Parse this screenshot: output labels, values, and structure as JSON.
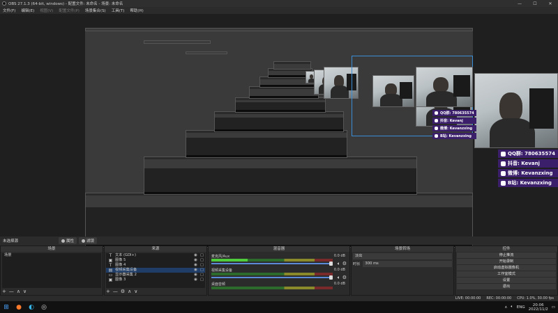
{
  "window": {
    "title": "OBS 27.1.3 (64-bit, windows) - 配置文件: 未命名 - 场景: 未命名",
    "minimize": "—",
    "maximize": "☐",
    "close": "✕"
  },
  "menu": [
    {
      "label": "文件(F)",
      "dim": false
    },
    {
      "label": "编辑(E)",
      "dim": false
    },
    {
      "label": "视图(V)",
      "dim": true
    },
    {
      "label": "配置文件(P)",
      "dim": true
    },
    {
      "label": "场景集合(S)",
      "dim": false
    },
    {
      "label": "工具(T)",
      "dim": false
    },
    {
      "label": "帮助(H)",
      "dim": false
    }
  ],
  "overlay": {
    "rows": [
      {
        "label": "QQ群: 780635574"
      },
      {
        "label": "抖音: Kevanj"
      },
      {
        "label": "微博: Kevanzxing"
      },
      {
        "label": "B站: Kevanzxing"
      }
    ]
  },
  "toolbar": {
    "scene_name": "未选择源",
    "properties": "属性",
    "filters": "滤镜"
  },
  "scenes": {
    "title": "场景",
    "items": [
      "场景"
    ],
    "add": "+",
    "remove": "—",
    "up": "∧",
    "down": "∨"
  },
  "sources": {
    "title": "来源",
    "items": [
      {
        "icon": "T",
        "label": "文本 (GDI+)"
      },
      {
        "icon": "▣",
        "label": "图像 5"
      },
      {
        "icon": "T",
        "label": "图像 4"
      },
      {
        "icon": "▤",
        "label": "视频采集设备"
      },
      {
        "icon": "▭",
        "label": "显示器采集 2"
      },
      {
        "icon": "▣",
        "label": "图像 3"
      }
    ],
    "add": "+",
    "remove": "—",
    "settings": "⚙",
    "up": "∧",
    "down": "∨"
  },
  "mixer": {
    "title": "混音器",
    "channels": [
      {
        "name": "麦克风/Aux",
        "db": "0.0 dB",
        "active": true
      },
      {
        "name": "视频采集设备",
        "db": "0.0 dB",
        "active": false
      },
      {
        "name": "桌面音频",
        "db": "0.0 dB",
        "active": false
      }
    ]
  },
  "transitions": {
    "title": "场景转场",
    "selected": "淡出",
    "duration_label": "时长",
    "duration_value": "300 ms"
  },
  "controls": {
    "title": "控件",
    "buttons": [
      "停止推流",
      "开始录制",
      "启动虚拟摄像机",
      "工作室模式",
      "设置",
      "退出"
    ]
  },
  "status": {
    "live": "LIVE: 00:00:00",
    "rec": "REC: 00:00:00",
    "cpu": "CPU: 1.0%, 30.00 fps"
  },
  "taskbar": {
    "lang": "ENG",
    "time": "20:06",
    "date": "2022/11/2"
  }
}
